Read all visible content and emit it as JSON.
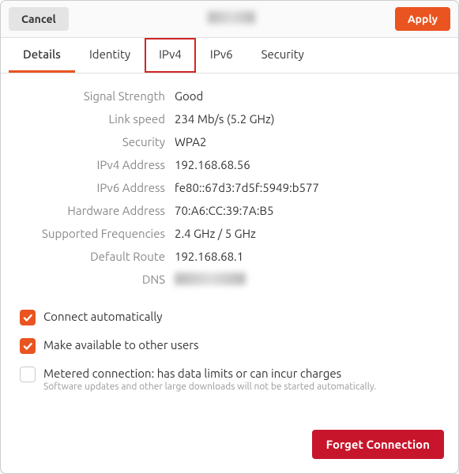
{
  "header": {
    "cancel_label": "Cancel",
    "apply_label": "Apply"
  },
  "tabs": {
    "details": "Details",
    "identity": "Identity",
    "ipv4": "IPv4",
    "ipv6": "IPv6",
    "security": "Security"
  },
  "details": {
    "signal_strength": {
      "label": "Signal Strength",
      "value": "Good"
    },
    "link_speed": {
      "label": "Link speed",
      "value": "234 Mb/s (5.2 GHz)"
    },
    "security": {
      "label": "Security",
      "value": "WPA2"
    },
    "ipv4_address": {
      "label": "IPv4 Address",
      "value": "192.168.68.56"
    },
    "ipv6_address": {
      "label": "IPv6 Address",
      "value": "fe80::67d3:7d5f:5949:b577"
    },
    "hardware_address": {
      "label": "Hardware Address",
      "value": "70:A6:CC:39:7A:B5"
    },
    "supported_frequencies": {
      "label": "Supported Frequencies",
      "value": "2.4 GHz / 5 GHz"
    },
    "default_route": {
      "label": "Default Route",
      "value": "192.168.68.1"
    },
    "dns": {
      "label": "DNS"
    }
  },
  "options": {
    "connect_auto": {
      "label": "Connect automatically",
      "checked": true
    },
    "make_available": {
      "label": "Make available to other users",
      "checked": true
    },
    "metered": {
      "label": "Metered connection: has data limits or can incur charges",
      "sub": "Software updates and other large downloads will not be started automatically.",
      "checked": false
    }
  },
  "footer": {
    "forget_label": "Forget Connection"
  }
}
